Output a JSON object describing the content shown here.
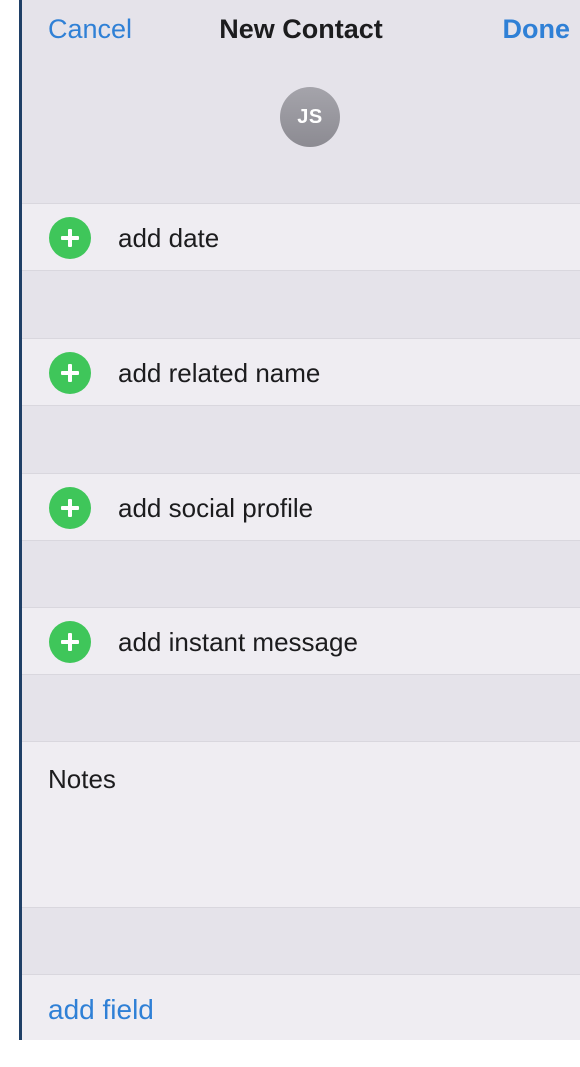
{
  "nav": {
    "cancel_label": "Cancel",
    "title": "New Contact",
    "done_label": "Done"
  },
  "avatar": {
    "initials": "JS"
  },
  "rows": [
    {
      "label": "add date",
      "icon": "add-circle-icon"
    },
    {
      "label": "add related name",
      "icon": "add-circle-icon"
    },
    {
      "label": "add social profile",
      "icon": "add-circle-icon"
    },
    {
      "label": "add instant message",
      "icon": "add-circle-icon"
    }
  ],
  "notes": {
    "label": "Notes"
  },
  "add_field": {
    "label": "add field"
  },
  "colors": {
    "accent": "#2f80d6",
    "add_icon": "#3fc65a",
    "background": "#e5e3ea",
    "row_background": "#efedf2"
  }
}
